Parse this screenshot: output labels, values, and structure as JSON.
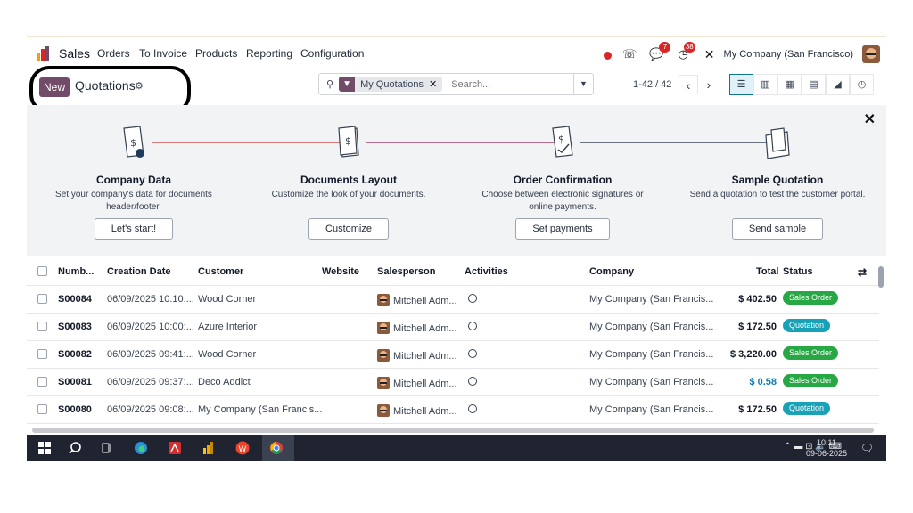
{
  "navbar": {
    "app_name": "Sales",
    "menus": [
      "Orders",
      "To Invoice",
      "Products",
      "Reporting",
      "Configuration"
    ],
    "messages_badge": "7",
    "activities_badge": "38",
    "company": "My Company (San Francisco)"
  },
  "control": {
    "new_label": "New",
    "title": "Quotations",
    "search_facet": "My Quotations",
    "search_placeholder": "Search...",
    "pager": "1-42 / 42"
  },
  "onboarding": {
    "steps": [
      {
        "title": "Company Data",
        "desc": "Set your company's data for documents header/footer.",
        "button": "Let's start!"
      },
      {
        "title": "Documents Layout",
        "desc": "Customize the look of your documents.",
        "button": "Customize"
      },
      {
        "title": "Order Confirmation",
        "desc": "Choose between electronic signatures or online payments.",
        "button": "Set payments"
      },
      {
        "title": "Sample Quotation",
        "desc": "Send a quotation to test the customer portal.",
        "button": "Send sample"
      }
    ]
  },
  "table": {
    "headers": {
      "number": "Numb...",
      "creation_date": "Creation Date",
      "customer": "Customer",
      "website": "Website",
      "salesperson": "Salesperson",
      "activities": "Activities",
      "company": "Company",
      "total": "Total",
      "status": "Status"
    },
    "rows": [
      {
        "number": "S00084",
        "date": "06/09/2025 10:10:...",
        "customer": "Wood Corner",
        "salesperson": "Mitchell Adm...",
        "company": "My Company (San Francis...",
        "total": "$ 402.50",
        "status": "Sales Order"
      },
      {
        "number": "S00083",
        "date": "06/09/2025 10:00:...",
        "customer": "Azure Interior",
        "salesperson": "Mitchell Adm...",
        "company": "My Company (San Francis...",
        "total": "$ 172.50",
        "status": "Quotation"
      },
      {
        "number": "S00082",
        "date": "06/09/2025 09:41:...",
        "customer": "Wood Corner",
        "salesperson": "Mitchell Adm...",
        "company": "My Company (San Francis...",
        "total": "$ 3,220.00",
        "status": "Sales Order"
      },
      {
        "number": "S00081",
        "date": "06/09/2025 09:37:...",
        "customer": "Deco Addict",
        "salesperson": "Mitchell Adm...",
        "company": "My Company (San Francis...",
        "total": "$ 0.58",
        "status": "Sales Order"
      },
      {
        "number": "S00080",
        "date": "06/09/2025 09:08:...",
        "customer": "My Company (San Francis...",
        "salesperson": "Mitchell Adm...",
        "company": "My Company (San Francis...",
        "total": "$ 172.50",
        "status": "Quotation"
      }
    ]
  },
  "taskbar": {
    "time": "10:11",
    "date": "09-06-2025"
  },
  "colors": {
    "brand": "#714b67",
    "sales_order": "#28a745",
    "quotation": "#17a2b8",
    "link_total": "#0f7ab8"
  }
}
